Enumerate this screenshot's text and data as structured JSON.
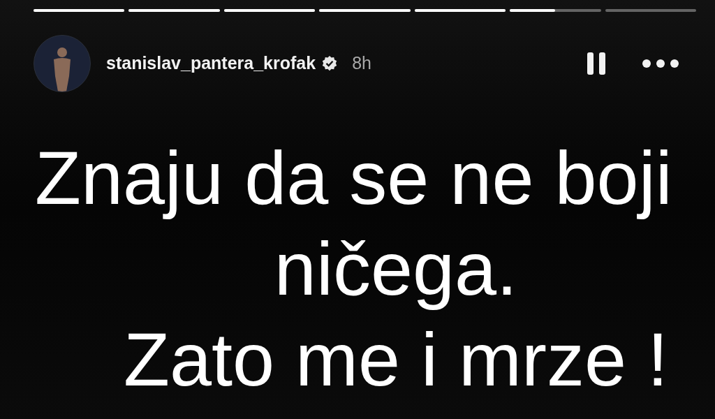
{
  "progress_segments": [
    {
      "level": 1
    },
    {
      "level": 1
    },
    {
      "level": 1
    },
    {
      "level": 1
    },
    {
      "level": 1
    },
    {
      "level": 0.5
    },
    {
      "level": 0
    }
  ],
  "header": {
    "username": "stanislav_pantera_krofak",
    "verified": true,
    "time": "8h"
  },
  "story_text": [
    "Znaju da se ne boji",
    "ničega.",
    "Zato me i mrze !"
  ]
}
